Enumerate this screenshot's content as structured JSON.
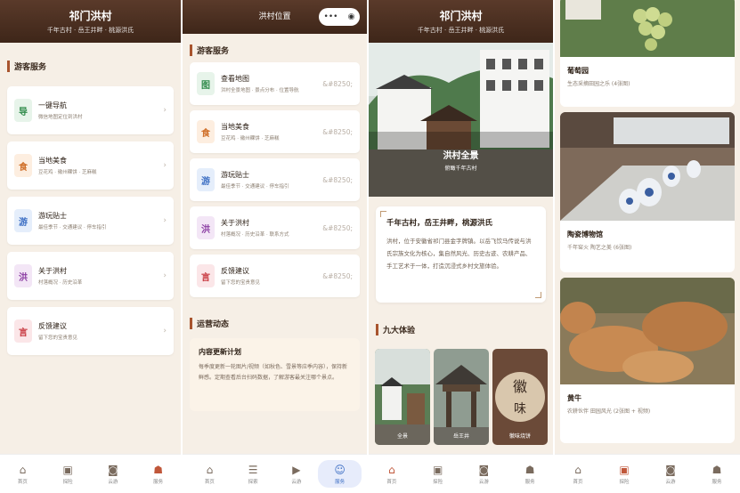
{
  "screen1": {
    "header_title": "祁门洪村",
    "header_subtitle": "千年古村 · 岳王井畔 · 桃源洪氏",
    "section_title": "游客服务",
    "services": [
      {
        "icon": "导",
        "title": "一键导航",
        "desc": "微信地图定位到洪村"
      },
      {
        "icon": "食",
        "title": "当地美食",
        "desc": "豆花鸡 · 徽州粿饼 · 芝麻糕"
      },
      {
        "icon": "游",
        "title": "游玩贴士",
        "desc": "最佳季节 · 交通建议 · 停车指引"
      },
      {
        "icon": "洪",
        "title": "关于洪村",
        "desc": "村落概况 · 历史沿革"
      },
      {
        "icon": "言",
        "title": "反馈建议",
        "desc": "留下您的宝贵意见"
      }
    ]
  },
  "screen2": {
    "header_title": "洪村位置",
    "section_title": "游客服务",
    "services": [
      {
        "icon": "图",
        "title": "查看地图",
        "desc": "洪村全景地图 · 景点分布 · 位置导航",
        "trail": "&#8250;"
      },
      {
        "icon": "食",
        "title": "当地美食",
        "desc": "豆花鸡 · 徽州粿饼 · 芝麻糕",
        "trail": "&#8250;"
      },
      {
        "icon": "游",
        "title": "游玩贴士",
        "desc": "最佳季节 · 交通建议 · 停车指引",
        "trail": "&#8250;"
      },
      {
        "icon": "洪",
        "title": "关于洪村",
        "desc": "村落概况 · 历史沿革 · 联系方式",
        "trail": "&#8250;"
      },
      {
        "icon": "言",
        "title": "反馈建议",
        "desc": "留下您的宝贵意见",
        "trail": "&#8250;"
      }
    ],
    "ops_title": "运营动态",
    "news_title": "内容更新计划",
    "news_body": "每季度更新一轮图片/视频（如秋色、雪景等应季内容），保持新鲜感。定期查看后台扫码数据，了解游客最关注哪个景点。"
  },
  "screen3": {
    "header_title": "祁门洪村",
    "header_subtitle": "千年古村 · 岳王井畔 · 桃源洪氏",
    "hero_title": "洪村全景",
    "hero_subtitle": "俯瞰千年古村",
    "intro_title": "千年古村，岳王井畔，桃源洪氏",
    "intro_body": "洪村，位于安徽省祁门县金字牌镇。以岳飞饮马传说与洪氏宗族文化为核心，集自然风光、历史古迹、农耕产品、手工艺术于一体，打造沉浸式乡村文旅体验。",
    "section_title": "九大体验",
    "experiences": [
      "全景",
      "岳王井",
      "徽味烧饼"
    ]
  },
  "screen4": {
    "cards": [
      {
        "title": "葡萄园",
        "desc": "生态采摘田园之乐 (4张图)"
      },
      {
        "title": "陶瓷博物馆",
        "desc": "千年窑火 陶艺之美 (6张图)"
      },
      {
        "title": "黄牛",
        "desc": "农耕伙伴 田园风光 (2张图 + 视频)"
      }
    ]
  },
  "tabs_a": [
    "首页",
    "探险",
    "云游",
    "服务"
  ],
  "tabs_b": [
    "首页",
    "探索",
    "云游",
    "服务"
  ]
}
